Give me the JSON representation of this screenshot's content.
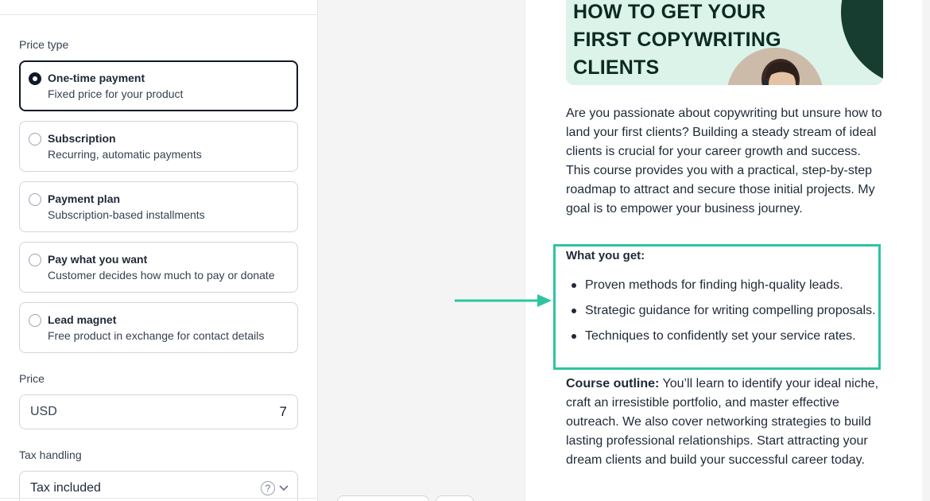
{
  "settings": {
    "price_type_label": "Price type",
    "options": [
      {
        "title": "One-time payment",
        "desc": "Fixed price for your product",
        "selected": true
      },
      {
        "title": "Subscription",
        "desc": "Recurring, automatic payments",
        "selected": false
      },
      {
        "title": "Payment plan",
        "desc": "Subscription-based installments",
        "selected": false
      },
      {
        "title": "Pay what you want",
        "desc": "Customer decides how much to pay or donate",
        "selected": false
      },
      {
        "title": "Lead magnet",
        "desc": "Free product in exchange for contact details",
        "selected": false
      }
    ],
    "price_label": "Price",
    "currency": "USD",
    "price_value": "7",
    "tax_label": "Tax handling",
    "tax_value": "Tax included",
    "help_glyph": "?"
  },
  "preview": {
    "banner_lines": [
      "HOW TO GET YOUR",
      "FIRST COPYWRITING",
      "CLIENTS"
    ],
    "intro": "Are you passionate about copywriting but unsure how to land your first clients? Building a steady stream of ideal clients is crucial for your career growth and success. This course provides you with a practical, step-by-step roadmap to attract and secure those initial projects. My goal is to empower your business journey.",
    "what_you_get_title": "What you get:",
    "bullets": [
      "Proven methods for finding high-quality leads.",
      "Strategic guidance for writing compelling proposals.",
      "Techniques to confidently set your service rates."
    ],
    "outline_label": "Course outline:",
    "outline_text": " You’ll learn to identify your ideal niche, craft an irresistible portfolio, and master effective outreach. We also cover networking strategies to build lasting professional relationships. Start attracting your dream clients and build your successful career today."
  },
  "colors": {
    "highlight": "#2cc5a0",
    "banner_bg": "#dcf3ea",
    "banner_dark": "#163d2f"
  },
  "icons": [
    "help-icon",
    "chevron-down-icon",
    "arrow-right-icon"
  ]
}
